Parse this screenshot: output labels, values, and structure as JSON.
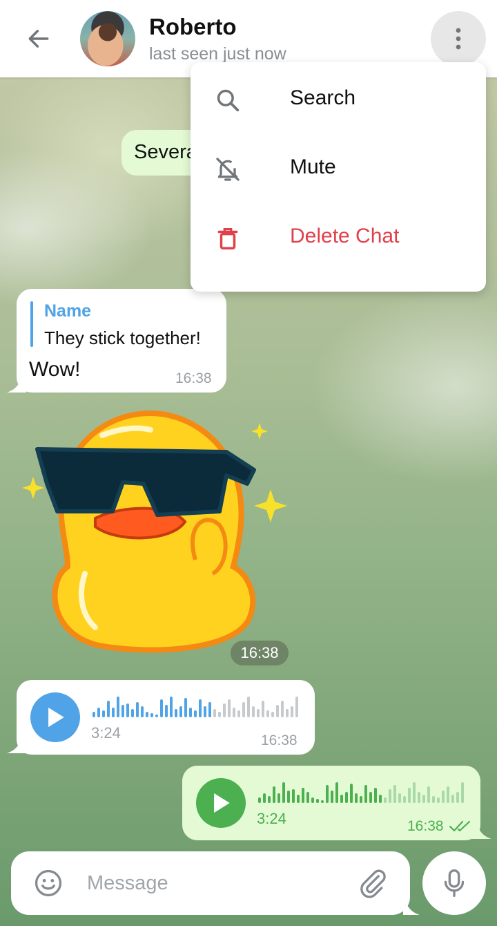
{
  "header": {
    "contact_name": "Roberto",
    "status": "last seen just now",
    "back_icon": "arrow-left-icon",
    "more_icon": "more-vertical-icon"
  },
  "menu": {
    "items": [
      {
        "label": "Search",
        "icon": "search-icon"
      },
      {
        "label": "Mute",
        "icon": "bell-off-icon"
      },
      {
        "label": "Delete Chat",
        "icon": "trash-icon",
        "color": "#e0404b"
      }
    ]
  },
  "messages": {
    "partial_text": "Severa",
    "reply_message": {
      "reply_name": "Name",
      "reply_text": "They stick together!",
      "text": "Wow!",
      "time": "16:38"
    },
    "sticker": {
      "time": "16:38"
    },
    "voice_in": {
      "duration": "3:24",
      "time": "16:38",
      "accent": "#4fa3e6",
      "progress": 0.58
    },
    "voice_out": {
      "duration": "3:24",
      "time": "16:38",
      "accent": "#4caf50",
      "progress": 0.6
    }
  },
  "composer": {
    "placeholder": "Message",
    "emoji_icon": "smile-icon",
    "attach_icon": "paperclip-icon",
    "mic_icon": "microphone-icon"
  },
  "colors": {
    "header_bg": "#ffffff",
    "outgoing_bubble": "#e4fad4",
    "incoming_bubble": "#ffffff",
    "danger": "#e0404b",
    "link_blue": "#4fa3e6"
  }
}
